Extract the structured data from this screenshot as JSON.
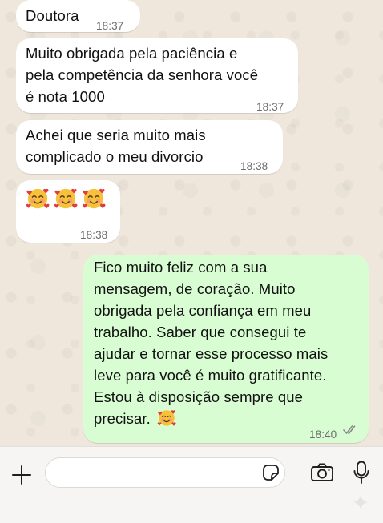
{
  "messages": [
    {
      "direction": "in",
      "text": "Doutora",
      "time": "18:37"
    },
    {
      "direction": "in",
      "text": "Muito obrigada pela paciência e\npela competência da senhora você\né nota 1000",
      "time": "18:37"
    },
    {
      "direction": "in",
      "text": "Achei que seria muito mais\ncomplicado o meu divorcio",
      "time": "18:38"
    },
    {
      "direction": "in",
      "emoji": [
        "smiling-face-with-hearts",
        "smiling-face-with-hearts",
        "smiling-face-with-hearts"
      ],
      "time": "18:38"
    },
    {
      "direction": "out",
      "text": "Fico muito feliz com a sua\nmensagem, de coração. Muito\nobrigada pela confiança em meu\ntrabalho. Saber que consegui te\najudar e tornar esse processo mais\nleve para você é muito gratificante.\nEstou à disposição sempre que\nprecisar.",
      "trailing_emoji": "smiling-face-with-hearts",
      "time": "18:40",
      "status": "read-double-check"
    }
  ],
  "composer": {
    "placeholder": "",
    "icons": [
      "plus-icon",
      "sticker-icon",
      "camera-icon",
      "microphone-icon"
    ]
  },
  "colors": {
    "wallpaper": "#efe7dc",
    "incoming_bubble": "#ffffff",
    "outgoing_bubble": "#d9fdd3",
    "timestamp": "#6b6b6b",
    "read_ticks": "#8a8a8a"
  }
}
